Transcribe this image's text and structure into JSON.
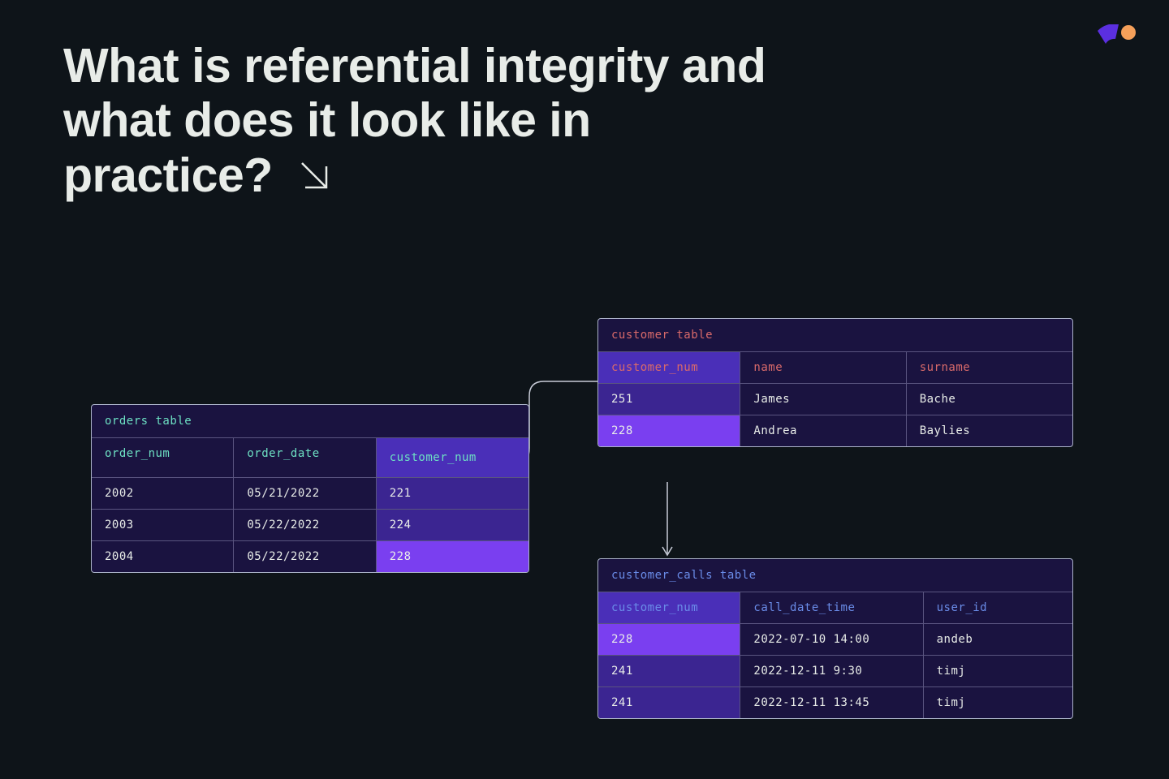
{
  "title": "What is referential integrity and what does it look like in practice?",
  "tables": {
    "orders": {
      "caption": "orders table",
      "columns": [
        "order_num",
        "order_date",
        "customer_num"
      ],
      "rows": [
        [
          "2002",
          "05/21/2022",
          "221"
        ],
        [
          "2003",
          "05/22/2022",
          "224"
        ],
        [
          "2004",
          "05/22/2022",
          "228"
        ]
      ]
    },
    "customer": {
      "caption": "customer table",
      "columns": [
        "customer_num",
        "name",
        "surname"
      ],
      "rows": [
        [
          "251",
          "James",
          "Bache"
        ],
        [
          "228",
          "Andrea",
          "Baylies"
        ]
      ]
    },
    "calls": {
      "caption": "customer_calls table",
      "columns": [
        "customer_num",
        "call_date_time",
        "user_id"
      ],
      "rows": [
        [
          "228",
          "2022-07-10 14:00",
          "andeb"
        ],
        [
          "241",
          "2022-12-11 9:30",
          "timj"
        ],
        [
          "241",
          "2022-12-11 13:45",
          "timj"
        ]
      ]
    }
  },
  "colors": {
    "bg": "#0e1419",
    "table_bg": "#1a1340",
    "pk_fk_col": "#3b2591",
    "highlight": "#7a3ff0",
    "border": "#aab2c8",
    "orders_accent": "#6de0c3",
    "customer_accent": "#d96a6a",
    "calls_accent": "#6a8ce8",
    "text": "#e8ece8",
    "logo_purple": "#5b2fe0",
    "logo_orange": "#f5a05a"
  }
}
